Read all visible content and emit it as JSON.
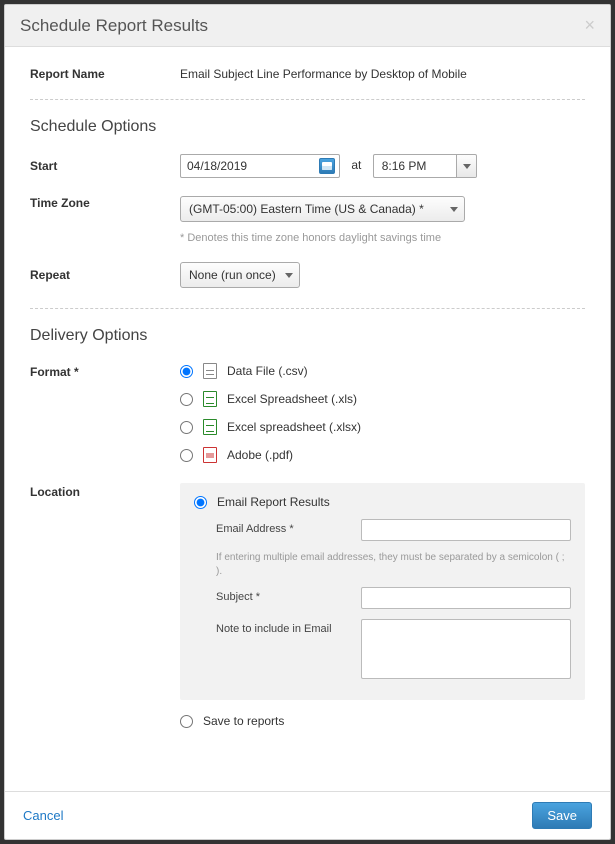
{
  "header": {
    "title": "Schedule Report Results"
  },
  "report": {
    "name_label": "Report Name",
    "name_value": "Email Subject Line Performance by Desktop of Mobile"
  },
  "schedule": {
    "section_title": "Schedule Options",
    "start_label": "Start",
    "start_date": "04/18/2019",
    "at_label": "at",
    "start_time": "8:16 PM",
    "tz_label": "Time Zone",
    "tz_value": "(GMT-05:00) Eastern Time (US & Canada) *",
    "tz_hint": "* Denotes this time zone honors daylight savings time",
    "repeat_label": "Repeat",
    "repeat_value": "None (run once)"
  },
  "delivery": {
    "section_title": "Delivery Options",
    "format_label": "Format *",
    "formats": {
      "csv": "Data File (.csv)",
      "xls": "Excel Spreadsheet (.xls)",
      "xlsx": "Excel spreadsheet (.xlsx)",
      "pdf": "Adobe (.pdf)"
    },
    "location_label": "Location",
    "email_option_label": "Email Report Results",
    "email_address_label": "Email Address *",
    "email_hint": "If entering multiple email addresses, they must be separated by a semicolon ( ; ).",
    "subject_label": "Subject *",
    "note_label": "Note to include in Email",
    "save_to_reports_label": "Save to reports"
  },
  "footer": {
    "cancel": "Cancel",
    "save": "Save"
  }
}
